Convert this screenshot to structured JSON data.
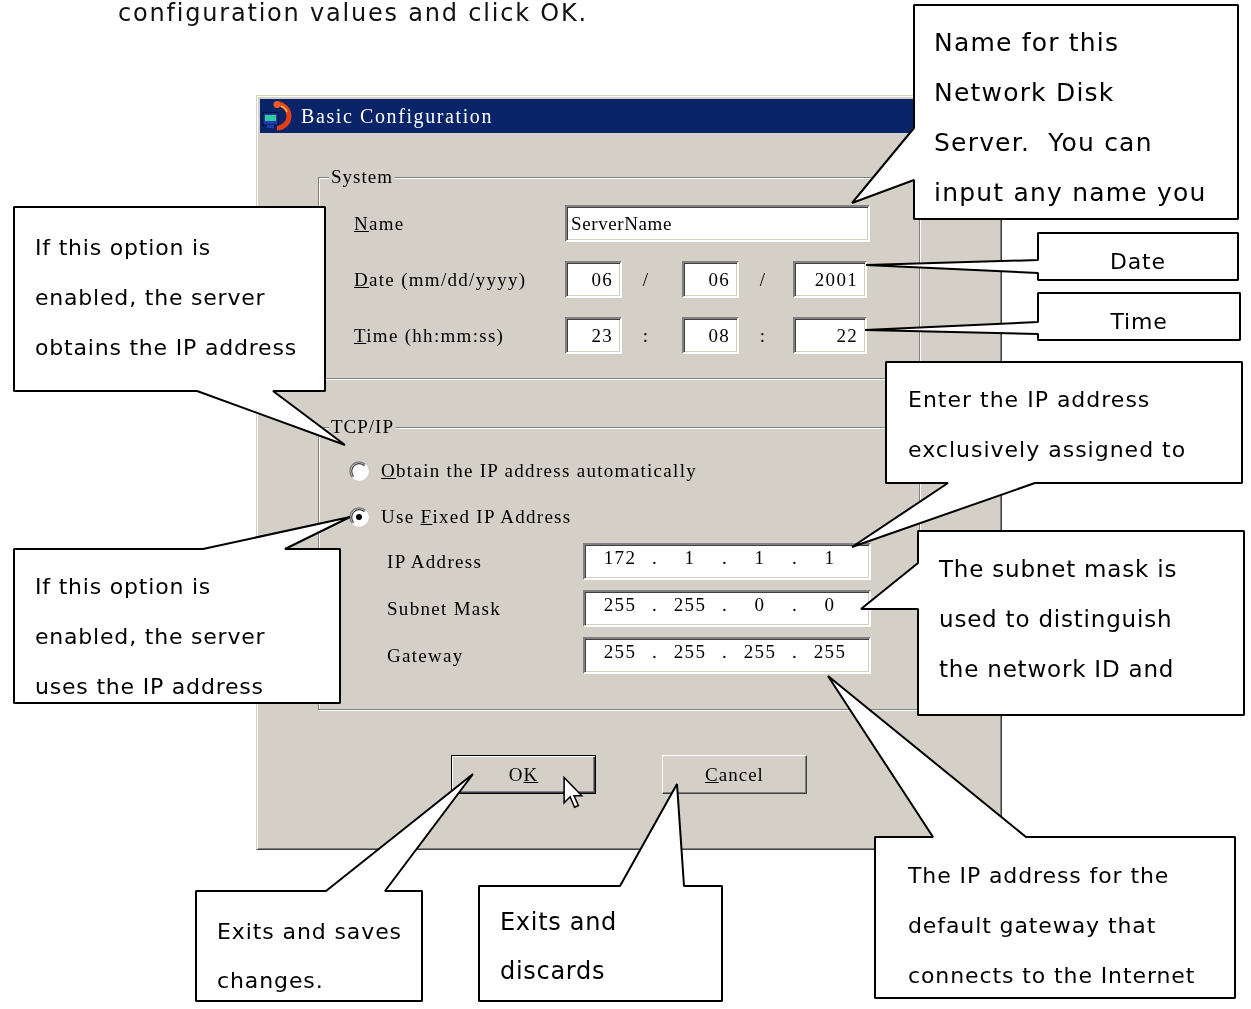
{
  "instruction": "configuration values and click OK.",
  "dialog": {
    "title": "Basic Configuration",
    "system_group": {
      "title": "System",
      "name": {
        "label": {
          "key": "N",
          "post": "ame"
        },
        "value": "ServerName"
      },
      "date": {
        "label": {
          "key": "D",
          "post": "ate (mm/dd/yyyy)"
        },
        "fields": [
          "06",
          "06",
          "2001"
        ],
        "separators": [
          "/",
          "/"
        ]
      },
      "time": {
        "label": {
          "key": "T",
          "post": "ime (hh:mm:ss)"
        },
        "fields": [
          "23",
          "08",
          "22"
        ],
        "separators": [
          ":",
          ":"
        ]
      }
    },
    "tcpip_group": {
      "title": "TCP/IP",
      "options": [
        {
          "label": {
            "key": "O",
            "post": "btain the IP address automatically"
          },
          "selected": false
        },
        {
          "label": {
            "pre": "Use ",
            "key": "F",
            "post": "ixed IP Address"
          },
          "selected": true
        }
      ],
      "addresses": [
        {
          "label": "IP Address",
          "octets": [
            "172",
            "1",
            "1",
            "1"
          ],
          "dots": [
            ".",
            ".",
            "."
          ]
        },
        {
          "label": "Subnet Mask",
          "octets": [
            "255",
            "255",
            "0",
            "0"
          ],
          "dots": [
            ".",
            ".",
            "."
          ]
        },
        {
          "label": "Gateway",
          "octets": [
            "255",
            "255",
            "255",
            "255"
          ],
          "dots": [
            ".",
            ".",
            "."
          ]
        }
      ]
    },
    "buttons": [
      {
        "label": {
          "pre": "O",
          "key": "K"
        },
        "default": true
      },
      {
        "label": {
          "key": "C",
          "post": "ancel"
        },
        "default": false
      }
    ]
  },
  "callouts": [
    {
      "lines": [
        "Name for this",
        "Network Disk",
        "Server.  You can",
        "input any name you"
      ]
    },
    {
      "lines": [
        "Date"
      ]
    },
    {
      "lines": [
        "Time"
      ]
    },
    {
      "lines": [
        "If this option is",
        "enabled, the server",
        "obtains the IP address"
      ]
    },
    {
      "lines": [
        "Enter the IP address",
        "exclusively assigned to"
      ]
    },
    {
      "lines": [
        "If this option is",
        "enabled, the server",
        "uses the IP address"
      ]
    },
    {
      "lines": [
        "The subnet mask is",
        "used to distinguish",
        "the network ID and"
      ]
    },
    {
      "lines": [
        "Exits and saves",
        "changes."
      ]
    },
    {
      "lines": [
        "Exits and",
        "discards"
      ]
    },
    {
      "lines": [
        "The IP address for the",
        "default gateway that",
        "connects to the Internet"
      ]
    }
  ]
}
